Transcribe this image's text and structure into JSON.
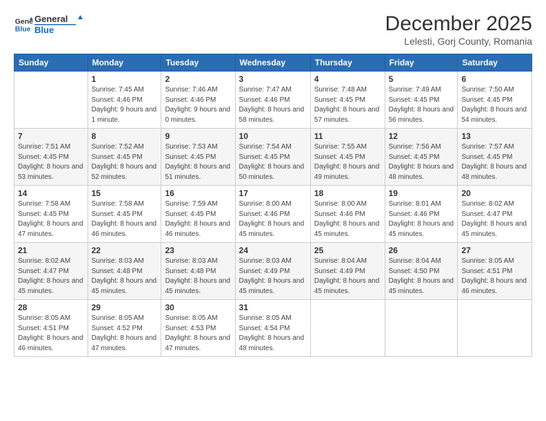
{
  "logo": {
    "line1": "General",
    "line2": "Blue"
  },
  "header": {
    "month": "December 2025",
    "location": "Lelesti, Gorj County, Romania"
  },
  "days_of_week": [
    "Sunday",
    "Monday",
    "Tuesday",
    "Wednesday",
    "Thursday",
    "Friday",
    "Saturday"
  ],
  "weeks": [
    [
      {
        "day": "",
        "sunrise": "",
        "sunset": "",
        "daylight": ""
      },
      {
        "day": "1",
        "sunrise": "Sunrise: 7:45 AM",
        "sunset": "Sunset: 4:46 PM",
        "daylight": "Daylight: 9 hours and 1 minute."
      },
      {
        "day": "2",
        "sunrise": "Sunrise: 7:46 AM",
        "sunset": "Sunset: 4:46 PM",
        "daylight": "Daylight: 9 hours and 0 minutes."
      },
      {
        "day": "3",
        "sunrise": "Sunrise: 7:47 AM",
        "sunset": "Sunset: 4:46 PM",
        "daylight": "Daylight: 8 hours and 58 minutes."
      },
      {
        "day": "4",
        "sunrise": "Sunrise: 7:48 AM",
        "sunset": "Sunset: 4:45 PM",
        "daylight": "Daylight: 8 hours and 57 minutes."
      },
      {
        "day": "5",
        "sunrise": "Sunrise: 7:49 AM",
        "sunset": "Sunset: 4:45 PM",
        "daylight": "Daylight: 8 hours and 56 minutes."
      },
      {
        "day": "6",
        "sunrise": "Sunrise: 7:50 AM",
        "sunset": "Sunset: 4:45 PM",
        "daylight": "Daylight: 8 hours and 54 minutes."
      }
    ],
    [
      {
        "day": "7",
        "sunrise": "Sunrise: 7:51 AM",
        "sunset": "Sunset: 4:45 PM",
        "daylight": "Daylight: 8 hours and 53 minutes."
      },
      {
        "day": "8",
        "sunrise": "Sunrise: 7:52 AM",
        "sunset": "Sunset: 4:45 PM",
        "daylight": "Daylight: 8 hours and 52 minutes."
      },
      {
        "day": "9",
        "sunrise": "Sunrise: 7:53 AM",
        "sunset": "Sunset: 4:45 PM",
        "daylight": "Daylight: 8 hours and 51 minutes."
      },
      {
        "day": "10",
        "sunrise": "Sunrise: 7:54 AM",
        "sunset": "Sunset: 4:45 PM",
        "daylight": "Daylight: 8 hours and 50 minutes."
      },
      {
        "day": "11",
        "sunrise": "Sunrise: 7:55 AM",
        "sunset": "Sunset: 4:45 PM",
        "daylight": "Daylight: 8 hours and 49 minutes."
      },
      {
        "day": "12",
        "sunrise": "Sunrise: 7:56 AM",
        "sunset": "Sunset: 4:45 PM",
        "daylight": "Daylight: 8 hours and 48 minutes."
      },
      {
        "day": "13",
        "sunrise": "Sunrise: 7:57 AM",
        "sunset": "Sunset: 4:45 PM",
        "daylight": "Daylight: 8 hours and 48 minutes."
      }
    ],
    [
      {
        "day": "14",
        "sunrise": "Sunrise: 7:58 AM",
        "sunset": "Sunset: 4:45 PM",
        "daylight": "Daylight: 8 hours and 47 minutes."
      },
      {
        "day": "15",
        "sunrise": "Sunrise: 7:58 AM",
        "sunset": "Sunset: 4:45 PM",
        "daylight": "Daylight: 8 hours and 46 minutes."
      },
      {
        "day": "16",
        "sunrise": "Sunrise: 7:59 AM",
        "sunset": "Sunset: 4:45 PM",
        "daylight": "Daylight: 8 hours and 46 minutes."
      },
      {
        "day": "17",
        "sunrise": "Sunrise: 8:00 AM",
        "sunset": "Sunset: 4:46 PM",
        "daylight": "Daylight: 8 hours and 45 minutes."
      },
      {
        "day": "18",
        "sunrise": "Sunrise: 8:00 AM",
        "sunset": "Sunset: 4:46 PM",
        "daylight": "Daylight: 8 hours and 45 minutes."
      },
      {
        "day": "19",
        "sunrise": "Sunrise: 8:01 AM",
        "sunset": "Sunset: 4:46 PM",
        "daylight": "Daylight: 8 hours and 45 minutes."
      },
      {
        "day": "20",
        "sunrise": "Sunrise: 8:02 AM",
        "sunset": "Sunset: 4:47 PM",
        "daylight": "Daylight: 8 hours and 45 minutes."
      }
    ],
    [
      {
        "day": "21",
        "sunrise": "Sunrise: 8:02 AM",
        "sunset": "Sunset: 4:47 PM",
        "daylight": "Daylight: 8 hours and 45 minutes."
      },
      {
        "day": "22",
        "sunrise": "Sunrise: 8:03 AM",
        "sunset": "Sunset: 4:48 PM",
        "daylight": "Daylight: 8 hours and 45 minutes."
      },
      {
        "day": "23",
        "sunrise": "Sunrise: 8:03 AM",
        "sunset": "Sunset: 4:48 PM",
        "daylight": "Daylight: 8 hours and 45 minutes."
      },
      {
        "day": "24",
        "sunrise": "Sunrise: 8:03 AM",
        "sunset": "Sunset: 4:49 PM",
        "daylight": "Daylight: 8 hours and 45 minutes."
      },
      {
        "day": "25",
        "sunrise": "Sunrise: 8:04 AM",
        "sunset": "Sunset: 4:49 PM",
        "daylight": "Daylight: 8 hours and 45 minutes."
      },
      {
        "day": "26",
        "sunrise": "Sunrise: 8:04 AM",
        "sunset": "Sunset: 4:50 PM",
        "daylight": "Daylight: 8 hours and 45 minutes."
      },
      {
        "day": "27",
        "sunrise": "Sunrise: 8:05 AM",
        "sunset": "Sunset: 4:51 PM",
        "daylight": "Daylight: 8 hours and 46 minutes."
      }
    ],
    [
      {
        "day": "28",
        "sunrise": "Sunrise: 8:05 AM",
        "sunset": "Sunset: 4:51 PM",
        "daylight": "Daylight: 8 hours and 46 minutes."
      },
      {
        "day": "29",
        "sunrise": "Sunrise: 8:05 AM",
        "sunset": "Sunset: 4:52 PM",
        "daylight": "Daylight: 8 hours and 47 minutes."
      },
      {
        "day": "30",
        "sunrise": "Sunrise: 8:05 AM",
        "sunset": "Sunset: 4:53 PM",
        "daylight": "Daylight: 8 hours and 47 minutes."
      },
      {
        "day": "31",
        "sunrise": "Sunrise: 8:05 AM",
        "sunset": "Sunset: 4:54 PM",
        "daylight": "Daylight: 8 hours and 48 minutes."
      },
      {
        "day": "",
        "sunrise": "",
        "sunset": "",
        "daylight": ""
      },
      {
        "day": "",
        "sunrise": "",
        "sunset": "",
        "daylight": ""
      },
      {
        "day": "",
        "sunrise": "",
        "sunset": "",
        "daylight": ""
      }
    ]
  ]
}
